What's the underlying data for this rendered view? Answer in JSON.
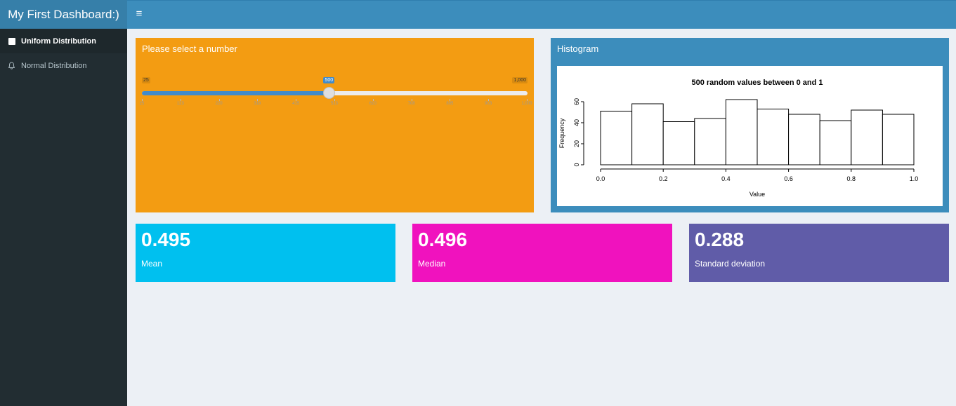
{
  "app": {
    "title": "My First Dashboard:)"
  },
  "header": {
    "toggle_icon": "hamburger-icon",
    "toggle_glyph": "≡"
  },
  "sidebar": {
    "items": [
      {
        "label": "Uniform Distribution",
        "icon": "square-icon",
        "active": true
      },
      {
        "label": "Normal Distribution",
        "icon": "bell-icon",
        "active": false
      }
    ]
  },
  "input_box": {
    "title": "Please select a number",
    "color": "#f39c12",
    "slider": {
      "min": 25,
      "max": 1000,
      "value": 500,
      "min_label": "25",
      "max_label": "1,000",
      "value_label": "500",
      "tick_labels": [
        "25",
        "123",
        "220",
        "318",
        "415",
        "513",
        "610",
        "708",
        "805",
        "903",
        "1,000"
      ]
    }
  },
  "histogram_box": {
    "title": "Histogram",
    "color": "#3c8dbc"
  },
  "chart_data": {
    "type": "bar",
    "title": "500 random values between 0 and 1",
    "xlabel": "Value",
    "ylabel": "Frequency",
    "bins": [
      [
        0.0,
        0.1
      ],
      [
        0.1,
        0.2
      ],
      [
        0.2,
        0.3
      ],
      [
        0.3,
        0.4
      ],
      [
        0.4,
        0.5
      ],
      [
        0.5,
        0.6
      ],
      [
        0.6,
        0.7
      ],
      [
        0.7,
        0.8
      ],
      [
        0.8,
        0.9
      ],
      [
        0.9,
        1.0
      ]
    ],
    "values": [
      51,
      58,
      41,
      44,
      62,
      53,
      48,
      42,
      52,
      48
    ],
    "xlim": [
      0,
      1
    ],
    "ylim": [
      0,
      60
    ],
    "xticks": [
      "0.0",
      "0.2",
      "0.4",
      "0.6",
      "0.8",
      "1.0"
    ],
    "yticks": [
      "0",
      "20",
      "40",
      "60"
    ],
    "grid": false
  },
  "value_boxes": [
    {
      "value": "0.495",
      "label": "Mean",
      "color": "#00c0ef"
    },
    {
      "value": "0.496",
      "label": "Median",
      "color": "#f012be"
    },
    {
      "value": "0.288",
      "label": "Standard deviation",
      "color": "#605ca8"
    }
  ]
}
